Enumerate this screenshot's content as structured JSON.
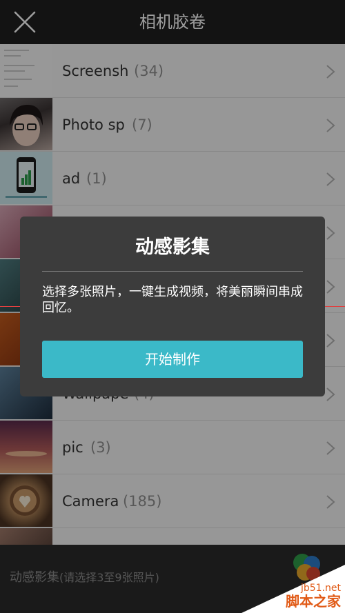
{
  "header": {
    "title": "相机胶卷"
  },
  "albums": [
    {
      "name": "Screensh",
      "count": "(34)"
    },
    {
      "name": "Photo sp",
      "count": "(7)"
    },
    {
      "name": "ad",
      "count": "(1)"
    },
    {
      "name": "",
      "count": ""
    },
    {
      "name": "",
      "count": ""
    },
    {
      "name": "",
      "count": ""
    },
    {
      "name": "Wallpape",
      "count": "(4)"
    },
    {
      "name": "pic",
      "count": "(3)"
    },
    {
      "name": "Camera",
      "count": "(185)"
    },
    {
      "name": "",
      "count": ""
    }
  ],
  "dialog": {
    "title": "动感影集",
    "description": "选择多张照片，一键生成视频，将美丽瞬间串成回忆。",
    "button": "开始制作"
  },
  "footer": {
    "label": "动感影集",
    "sublabel": "(请选择3至9张照片)"
  },
  "watermark": {
    "line1": "jb51.net",
    "line2": "脚本之家"
  },
  "colors": {
    "accent": "#3bb9c8",
    "dialog_bg": "#3c3c3c",
    "topbar_bg": "#1f1f1f"
  }
}
